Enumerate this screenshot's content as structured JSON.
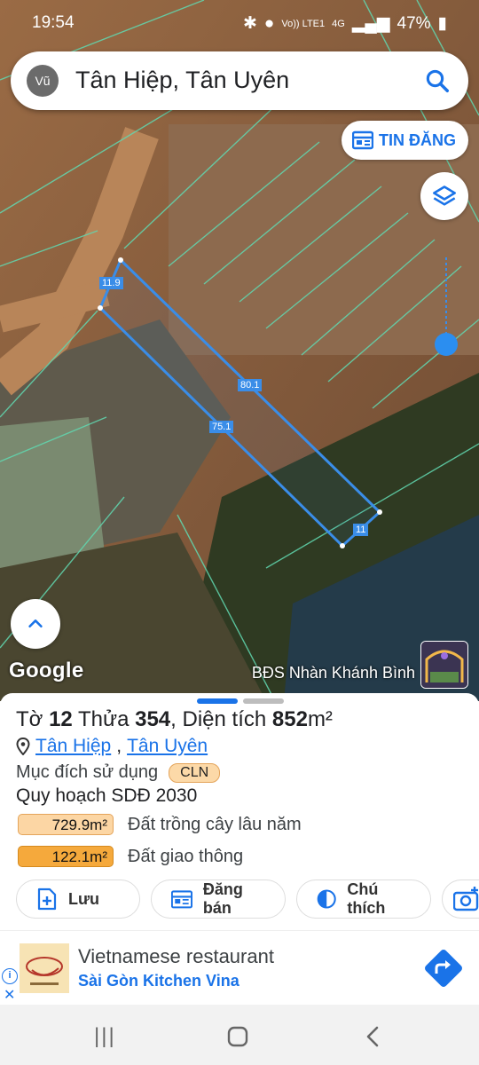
{
  "status_bar": {
    "time": "19:54",
    "network": "4G",
    "volte": "Vo)) LTE1",
    "battery": "47%"
  },
  "search": {
    "avatar": "Vũ",
    "query": "Tân Hiệp, Tân Uyên"
  },
  "map": {
    "tin_dang_label": "TIN ĐĂNG",
    "edge_labels": [
      "11.9",
      "80.1",
      "75.1",
      "11"
    ],
    "google_label": "Google",
    "brand_label": "BĐS Nhàn Khánh Bình",
    "parcel_color": "#3a8de8"
  },
  "parcel": {
    "to_label": "Tờ",
    "to_value": "12",
    "thua_label": "Thửa",
    "thua_value": "354",
    "area_label": "Diện tích",
    "area_value": "852",
    "area_unit": "m²",
    "ward": "Tân Hiệp",
    "district": "Tân Uyên",
    "purpose_label": "Mục đích sử dụng",
    "purpose_tag": "CLN",
    "plan_label": "Quy hoạch SDĐ 2030",
    "zones": [
      {
        "value": "729.9m²",
        "label": "Đất trồng cây lâu năm",
        "color": "#fcd6a4"
      },
      {
        "value": "122.1m²",
        "label": "Đất giao thông",
        "color": "#f5a93c"
      }
    ]
  },
  "actions": {
    "save": "Lưu",
    "post": "Đăng bán",
    "legend": "Chú thích"
  },
  "ad": {
    "title": "Vietnamese restaurant",
    "subtitle": "Sài Gòn Kitchen Vina"
  }
}
